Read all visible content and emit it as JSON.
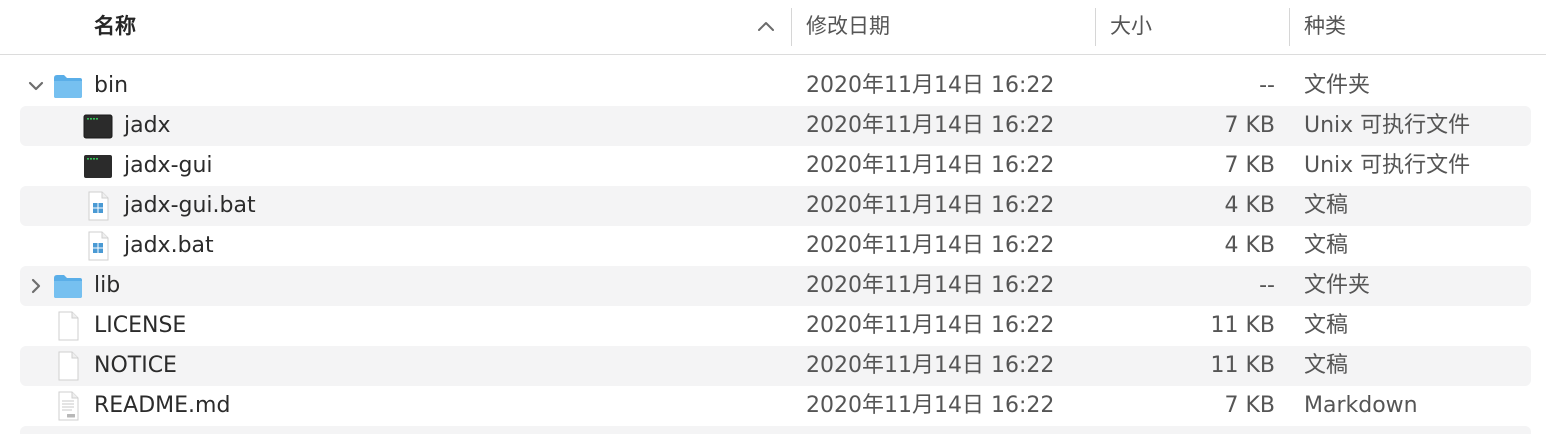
{
  "columns": {
    "name": "名称",
    "date": "修改日期",
    "size": "大小",
    "kind": "种类"
  },
  "rows": [
    {
      "name": "bin",
      "date": "2020年11月14日 16:22",
      "size": "--",
      "kind": "文件夹",
      "icon": "folder-icon",
      "disclosure": "expanded"
    },
    {
      "name": "jadx",
      "date": "2020年11月14日 16:22",
      "size": "7 KB",
      "kind": "Unix 可执行文件",
      "icon": "terminal-exec-icon"
    },
    {
      "name": "jadx-gui",
      "date": "2020年11月14日 16:22",
      "size": "7 KB",
      "kind": "Unix 可执行文件",
      "icon": "terminal-exec-icon"
    },
    {
      "name": "jadx-gui.bat",
      "date": "2020年11月14日 16:22",
      "size": "4 KB",
      "kind": "文稿",
      "icon": "windows-doc-icon"
    },
    {
      "name": "jadx.bat",
      "date": "2020年11月14日 16:22",
      "size": "4 KB",
      "kind": "文稿",
      "icon": "windows-doc-icon"
    },
    {
      "name": "lib",
      "date": "2020年11月14日 16:22",
      "size": "--",
      "kind": "文件夹",
      "icon": "folder-icon",
      "disclosure": "collapsed"
    },
    {
      "name": "LICENSE",
      "date": "2020年11月14日 16:22",
      "size": "11 KB",
      "kind": "文稿",
      "icon": "blank-doc-icon"
    },
    {
      "name": "NOTICE",
      "date": "2020年11月14日 16:22",
      "size": "11 KB",
      "kind": "文稿",
      "icon": "blank-doc-icon"
    },
    {
      "name": "README.md",
      "date": "2020年11月14日 16:22",
      "size": "7 KB",
      "kind": "Markdown",
      "icon": "markdown-doc-icon"
    }
  ],
  "colors": {
    "folder": "#5aaee8",
    "altRow": "#f4f4f5",
    "terminal": "#2b2b2b",
    "terminalText": "#36c15a"
  }
}
